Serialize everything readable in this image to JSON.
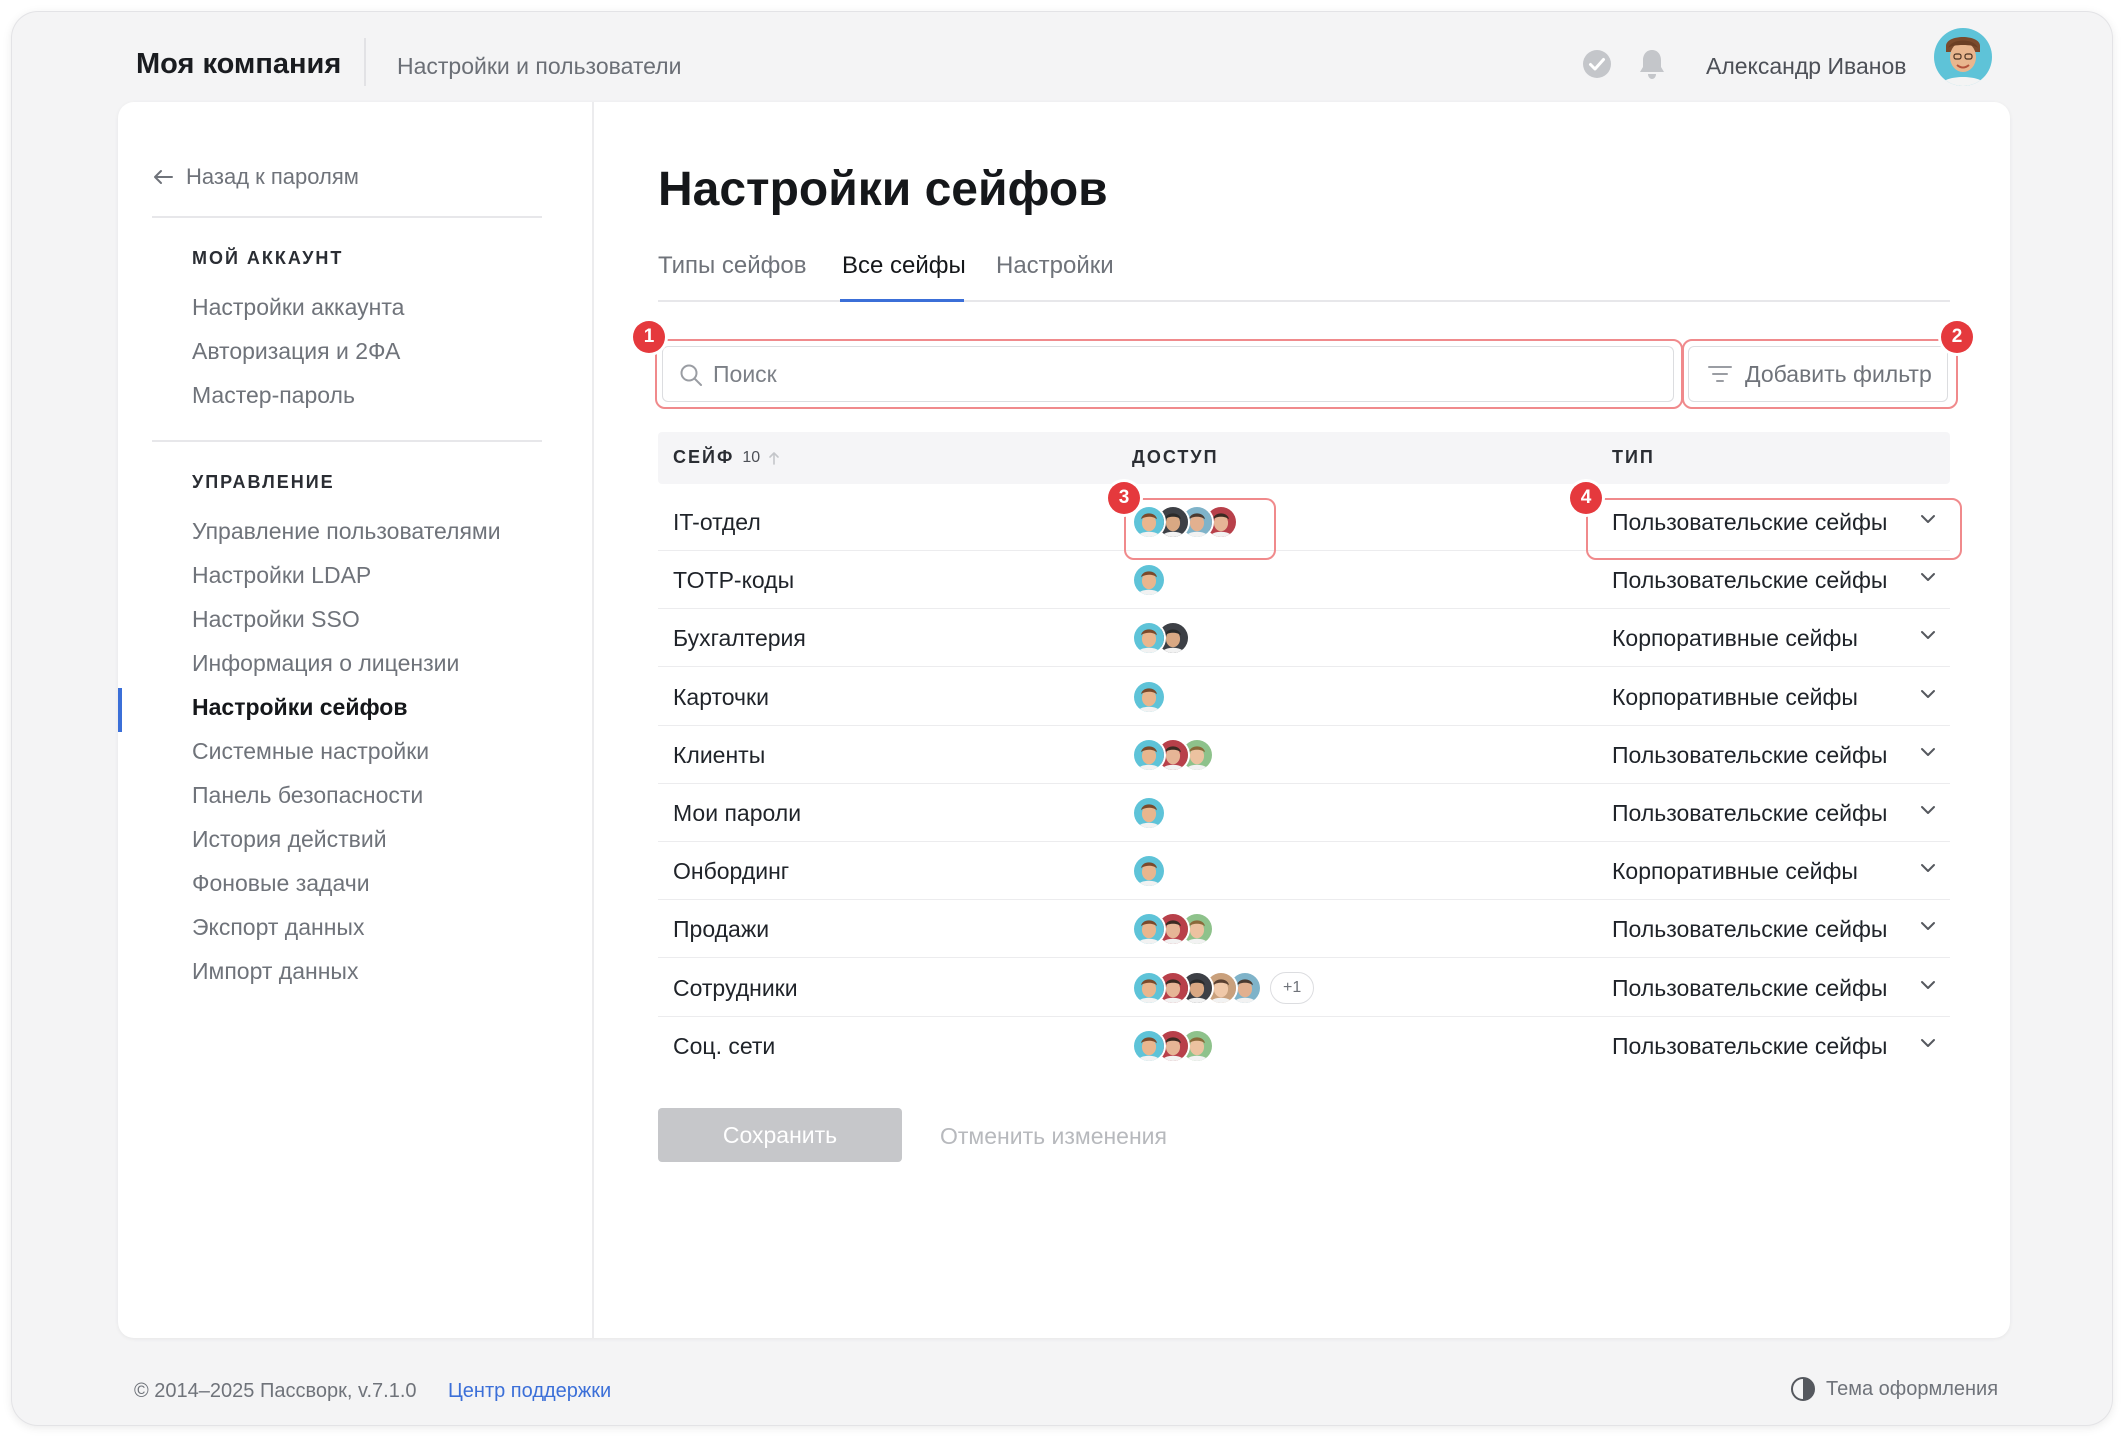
{
  "header": {
    "company": "Моя компания",
    "breadcrumb": "Настройки и пользователи",
    "user_name": "Александр Иванов"
  },
  "sidebar": {
    "back_label": "Назад к паролям",
    "sections": [
      {
        "heading": "МОЙ АККАУНТ",
        "items": [
          "Настройки аккаунта",
          "Авторизация и 2ФА",
          "Мастер-пароль"
        ]
      },
      {
        "heading": "УПРАВЛЕНИЕ",
        "items": [
          "Управление пользователями",
          "Настройки LDAP",
          "Настройки SSO",
          "Информация о лицензии",
          "Настройки сейфов",
          "Системные настройки",
          "Панель безопасности",
          "История действий",
          "Фоновые задачи",
          "Экспорт данных",
          "Импорт данных"
        ]
      }
    ],
    "active_item": "Настройки сейфов"
  },
  "main": {
    "title": "Настройки сейфов",
    "tabs": [
      "Типы сейфов",
      "Все сейфы",
      "Настройки"
    ],
    "active_tab": "Все сейфы",
    "search_placeholder": "Поиск",
    "filter_label": "Добавить фильтр",
    "columns": {
      "name": "СЕЙФ",
      "count": "10",
      "access": "ДОСТУП",
      "type": "ТИП"
    },
    "rows": [
      {
        "name": "IT-отдел",
        "avatars": 4,
        "more": "",
        "type": "Пользовательские сейфы"
      },
      {
        "name": "TOTP-коды",
        "avatars": 1,
        "more": "",
        "type": "Пользовательские сейфы"
      },
      {
        "name": "Бухгалтерия",
        "avatars": 2,
        "more": "",
        "type": "Корпоративные сейфы"
      },
      {
        "name": "Карточки",
        "avatars": 1,
        "more": "",
        "type": "Корпоративные сейфы"
      },
      {
        "name": "Клиенты",
        "avatars": 3,
        "more": "",
        "type": "Пользовательские сейфы"
      },
      {
        "name": "Мои пароли",
        "avatars": 1,
        "more": "",
        "type": "Пользовательские сейфы"
      },
      {
        "name": "Онбординг",
        "avatars": 1,
        "more": "",
        "type": "Корпоративные сейфы"
      },
      {
        "name": "Продажи",
        "avatars": 3,
        "more": "",
        "type": "Пользовательские сейфы"
      },
      {
        "name": "Сотрудники",
        "avatars": 5,
        "more": "+1",
        "type": "Пользовательские сейфы"
      },
      {
        "name": "Соц. сети",
        "avatars": 3,
        "more": "",
        "type": "Пользовательские сейфы"
      }
    ],
    "save_label": "Сохранить",
    "cancel_label": "Отменить изменения"
  },
  "annotations": [
    "1",
    "2",
    "3",
    "4"
  ],
  "footer": {
    "copyright": "© 2014–2025 Пассворк, v.7.1.0",
    "support": "Центр поддержки",
    "theme": "Тема оформления"
  },
  "colors": {
    "accent": "#3b6fd8",
    "annotation": "#e5393d",
    "annotation_border": "#f08a8c"
  },
  "icons": [
    "check-circle-icon",
    "bell-icon",
    "arrow-left-icon",
    "search-icon",
    "filter-icon",
    "sort-up-icon",
    "chevron-down-icon",
    "theme-icon"
  ]
}
